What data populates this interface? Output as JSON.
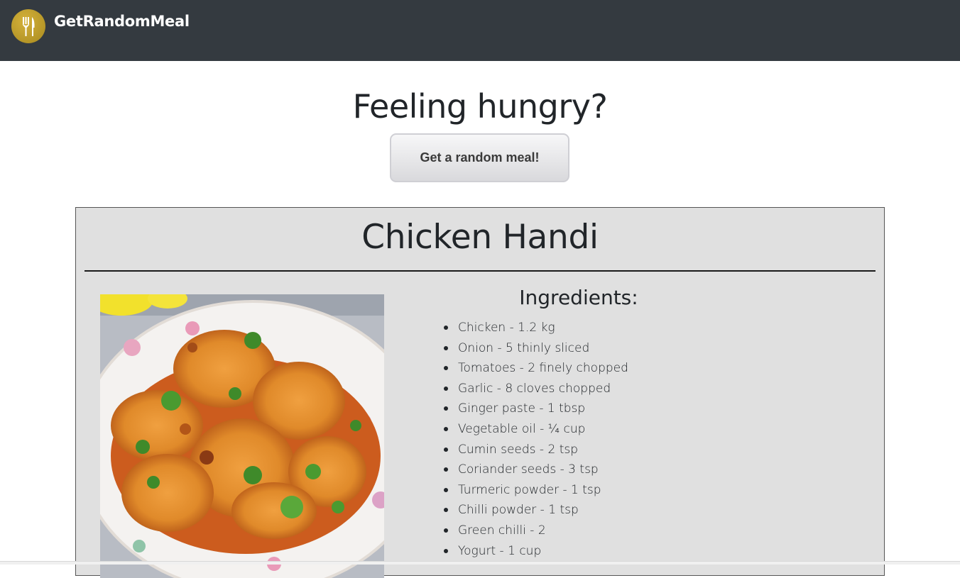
{
  "navbar": {
    "brand_name": "GetRandomMeal",
    "logo_icon": "fork-knife-icon",
    "logo_color": "#c7a52f",
    "background": "#343a40"
  },
  "hero": {
    "title": "Feeling hungry?",
    "button_label": "Get a random meal!"
  },
  "meal": {
    "name": "Chicken Handi",
    "image_icon": "meal-photo",
    "ingredients_heading": "Ingredients:",
    "ingredients": [
      "Chicken - 1.2 kg",
      "Onion - 5 thinly sliced",
      "Tomatoes - 2 finely chopped",
      "Garlic - 8 cloves chopped",
      "Ginger paste - 1 tbsp",
      "Vegetable oil - ¼ cup",
      "Cumin seeds - 2 tsp",
      "Coriander seeds - 3 tsp",
      "Turmeric powder - 1 tsp",
      "Chilli powder - 1 tsp",
      "Green chilli - 2",
      "Yogurt - 1 cup"
    ]
  }
}
